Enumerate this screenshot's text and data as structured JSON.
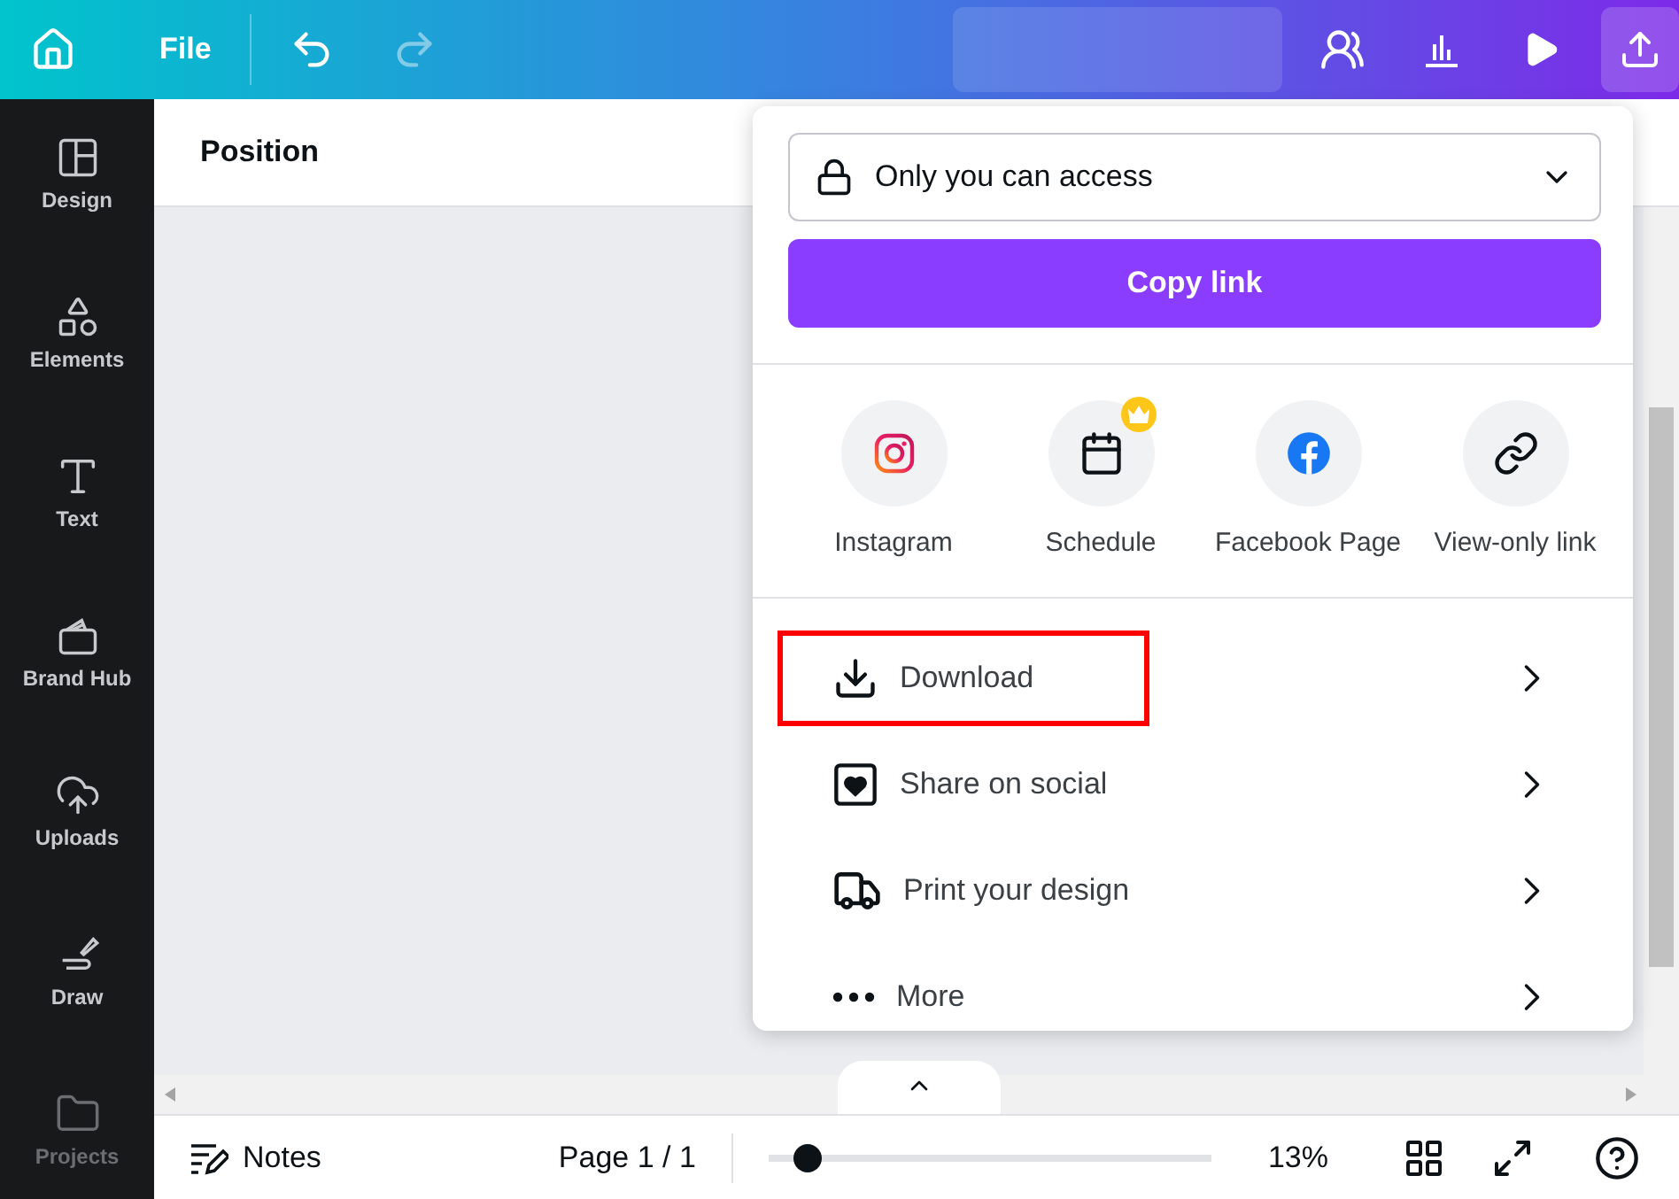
{
  "topbar": {
    "file_menu": "File",
    "redo_disabled": true
  },
  "sidebar": {
    "items": [
      {
        "label": "Design",
        "disabled": false
      },
      {
        "label": "Elements",
        "disabled": false
      },
      {
        "label": "Text",
        "disabled": false
      },
      {
        "label": "Brand Hub",
        "disabled": false
      },
      {
        "label": "Uploads",
        "disabled": false
      },
      {
        "label": "Draw",
        "disabled": false
      },
      {
        "label": "Projects",
        "disabled": true
      }
    ]
  },
  "toolbar": {
    "label": "Position"
  },
  "share_panel": {
    "access": {
      "value": "Only you can access"
    },
    "copy_button": "Copy link",
    "targets": [
      {
        "label": "Instagram",
        "premium": false
      },
      {
        "label": "Schedule",
        "premium": true
      },
      {
        "label": "Facebook Page",
        "premium": false
      },
      {
        "label": "View-only link",
        "premium": false
      }
    ],
    "menu": [
      {
        "label": "Download",
        "highlighted": true
      },
      {
        "label": "Share on social",
        "highlighted": false
      },
      {
        "label": "Print your design",
        "highlighted": false
      },
      {
        "label": "More",
        "highlighted": false
      }
    ]
  },
  "bottom_bar": {
    "notes": "Notes",
    "page": "Page 1 / 1",
    "zoom": {
      "level": 0.06
    },
    "zoom_reading": "13%"
  }
}
